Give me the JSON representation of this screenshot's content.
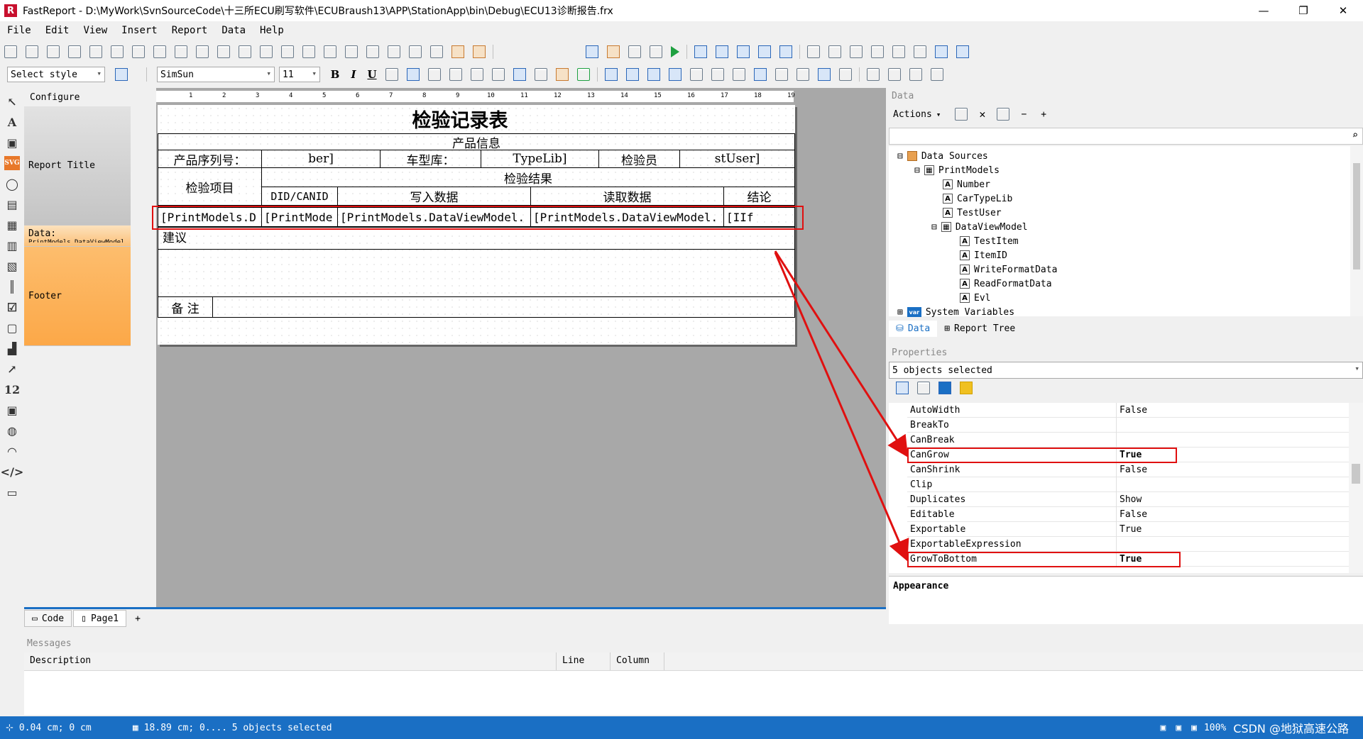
{
  "window": {
    "app_name": "FastReport",
    "title": "FastReport - D:\\MyWork\\SvnSourceCode\\十三所ECU刷写软件\\ECUBraush13\\APP\\StationApp\\bin\\Debug\\ECU13诊断报告.frx",
    "minimize": "—",
    "maximize": "❐",
    "close": "✕"
  },
  "menu": [
    "File",
    "Edit",
    "View",
    "Insert",
    "Report",
    "Data",
    "Help"
  ],
  "toolbar2": {
    "style_combo": "Select style",
    "font_combo": "SimSun",
    "size_combo": "11",
    "bold": "B",
    "italic": "I",
    "underline": "U"
  },
  "bands": {
    "configure": "Configure",
    "report_title": "Report Title",
    "data": "Data:",
    "data_sub": "PrintModels.DataViewModel",
    "footer": "Footer"
  },
  "ruler_marks": [
    "1",
    "2",
    "3",
    "4",
    "5",
    "6",
    "7",
    "8",
    "9",
    "10",
    "11",
    "12",
    "13",
    "14",
    "15",
    "16",
    "17",
    "18",
    "19"
  ],
  "report": {
    "title": "检验记录表",
    "product_info": "产品信息",
    "serial_label": "产品序列号：",
    "serial_value": "ber]",
    "car_label": "车型库：",
    "car_value": "TypeLib]",
    "inspector_label": "检验员",
    "inspector_value": "stUser]",
    "item_label": "检验项目",
    "result_label": "检验结果",
    "col_did": "DID/CANID",
    "col_write": "写入数据",
    "col_read": "读取数据",
    "col_conclusion": "结论",
    "data_cells": [
      "[PrintModels.D",
      "[PrintMode",
      "[PrintModels.DataViewModel.",
      "[PrintModels.DataViewModel.",
      "[IIf"
    ],
    "suggestion": "建议",
    "remark": "备 注"
  },
  "tabs": {
    "code": "Code",
    "page1": "Page1",
    "add": "+"
  },
  "data_panel": {
    "header": "Data",
    "actions": "Actions",
    "tree": [
      {
        "label": "Data Sources",
        "level": 0
      },
      {
        "label": "PrintModels",
        "level": 1
      },
      {
        "label": "Number",
        "level": 2
      },
      {
        "label": "CarTypeLib",
        "level": 2
      },
      {
        "label": "TestUser",
        "level": 2
      },
      {
        "label": "DataViewModel",
        "level": 2
      },
      {
        "label": "TestItem",
        "level": 3
      },
      {
        "label": "ItemID",
        "level": 3
      },
      {
        "label": "WriteFormatData",
        "level": 3
      },
      {
        "label": "ReadFormatData",
        "level": 3
      },
      {
        "label": "Evl",
        "level": 3
      },
      {
        "label": "System Variables",
        "level": 0
      }
    ],
    "tab_data": "Data",
    "tab_report_tree": "Report Tree"
  },
  "properties": {
    "header": "Properties",
    "selection": "5 objects selected",
    "rows": [
      {
        "name": "AutoWidth",
        "value": "False"
      },
      {
        "name": "BreakTo",
        "value": ""
      },
      {
        "name": "CanBreak",
        "value": ""
      },
      {
        "name": "CanGrow",
        "value": "True"
      },
      {
        "name": "CanShrink",
        "value": "False"
      },
      {
        "name": "Clip",
        "value": ""
      },
      {
        "name": "Duplicates",
        "value": "Show"
      },
      {
        "name": "Editable",
        "value": "False"
      },
      {
        "name": "Exportable",
        "value": "True"
      },
      {
        "name": "ExportableExpression",
        "value": ""
      },
      {
        "name": "GrowToBottom",
        "value": "True"
      }
    ],
    "category": "Appearance"
  },
  "messages": {
    "header": "Messages",
    "col_description": "Description",
    "col_line": "Line",
    "col_column": "Column"
  },
  "status": {
    "pos": "0.04 cm; 0 cm",
    "size": "18.89 cm; 0....",
    "selected": "5 objects selected",
    "zoom": "100%",
    "watermark": "CSDN @地狱高速公路"
  },
  "colors": {
    "highlight": "#e01010",
    "status_bg": "#1a6fc4",
    "band_orange": "#fca848"
  }
}
